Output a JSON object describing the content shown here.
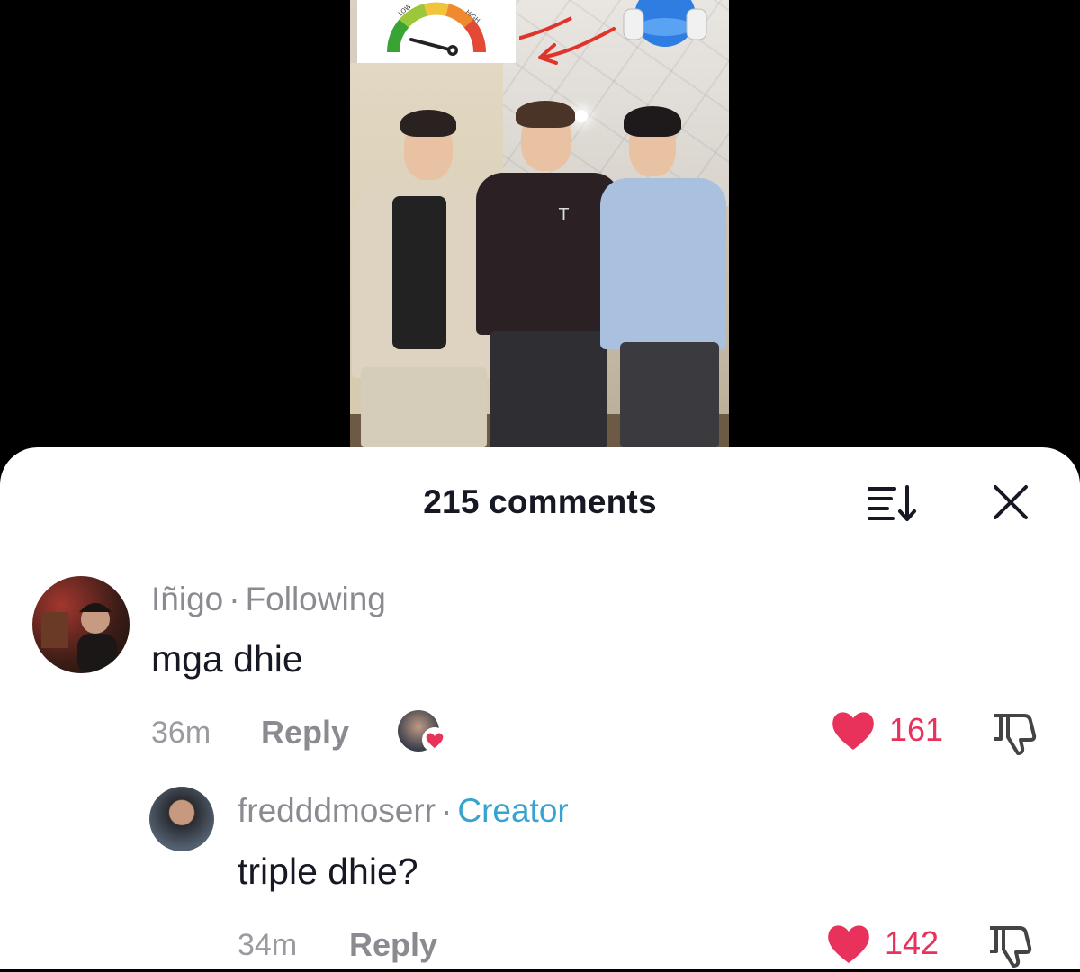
{
  "video": {
    "gauge": {
      "low_label": "LOW",
      "high_label": "HIGH"
    },
    "jacket_text": "T"
  },
  "sheet": {
    "title": "215 comments",
    "sort_icon": "sort-icon",
    "close_icon": "close-icon"
  },
  "comments": [
    {
      "username": "Iñigo",
      "tag": "Following",
      "text": "mga dhie",
      "time": "36m",
      "reply_label": "Reply",
      "likes": "161",
      "liked_by_creator": true
    },
    {
      "username": "fredddmoserr",
      "tag": "Creator",
      "text": "triple dhie?",
      "time": "34m",
      "reply_label": "Reply",
      "likes": "142"
    }
  ],
  "colors": {
    "like": "#e8315b",
    "creator_tag": "#36a3d0",
    "muted_text": "#8a8b91",
    "primary_text": "#161823"
  }
}
